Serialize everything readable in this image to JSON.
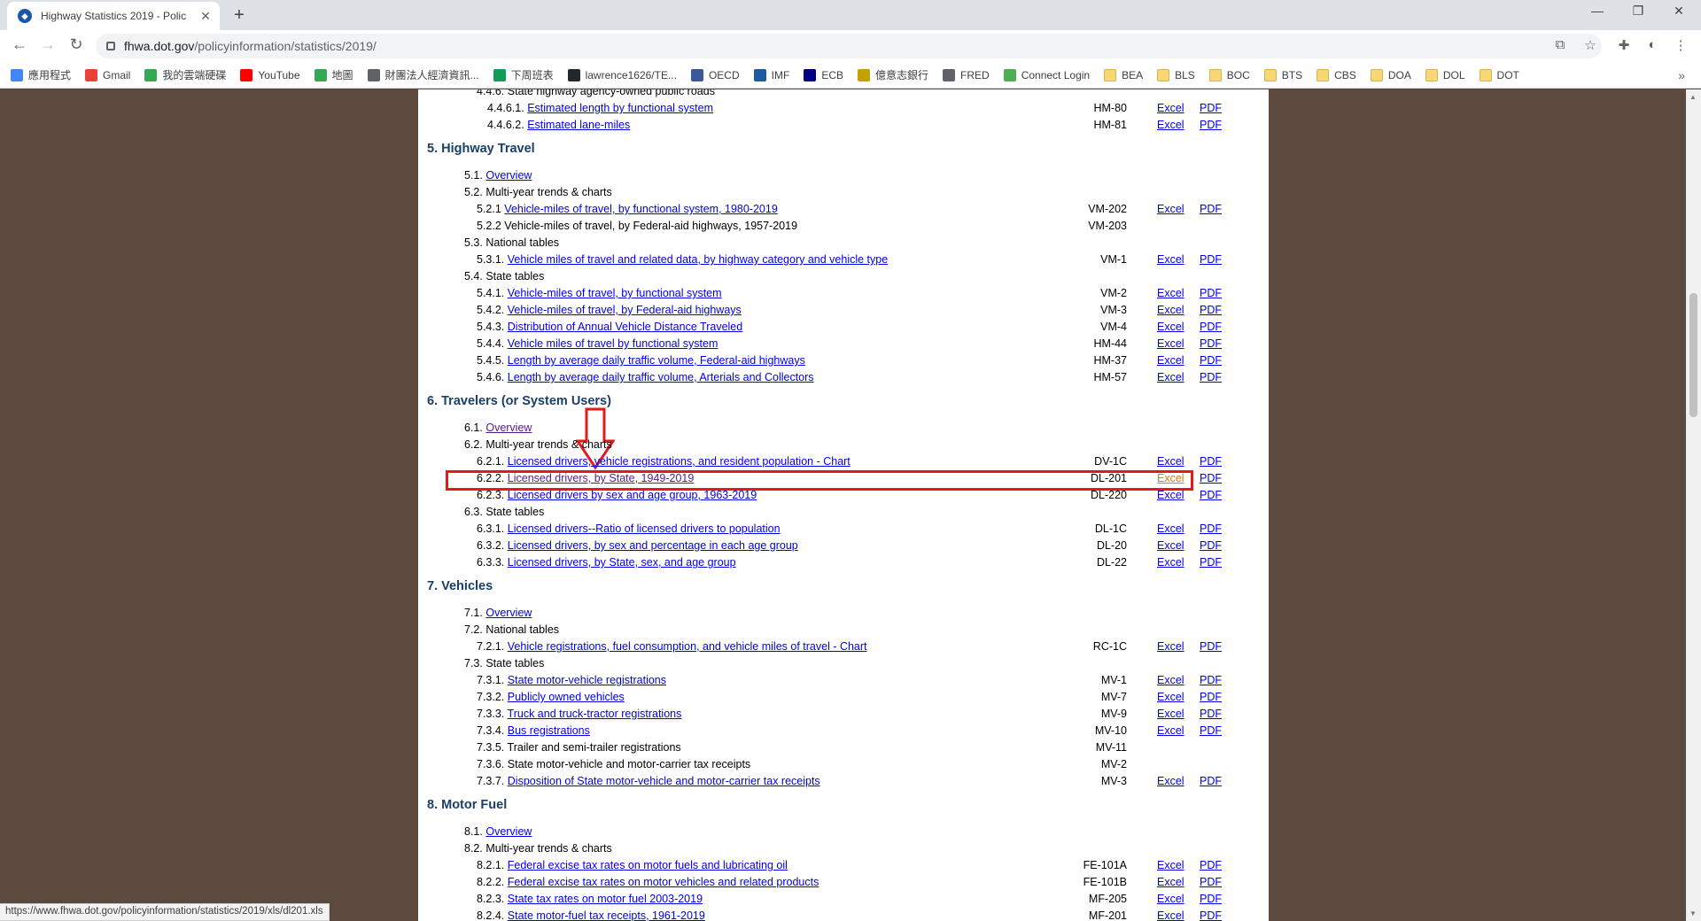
{
  "browser": {
    "tab_title": "Highway Statistics 2019 - Polic",
    "url_host": "fhwa.dot.gov",
    "url_path": "/policyinformation/statistics/2019/",
    "status_url": "https://www.fhwa.dot.gov/policyinformation/statistics/2019/xls/dl201.xls",
    "bookmarks": [
      "應用程式",
      "Gmail",
      "我的雲端硬碟",
      "YouTube",
      "地圖",
      "財團法人經濟資訊...",
      "下周班表",
      "lawrence1626/TE...",
      "OECD",
      "IMF",
      "ECB",
      "億意志銀行",
      "FRED",
      "Connect Login",
      "BEA",
      "BLS",
      "BOC",
      "BTS",
      "CBS",
      "DOA",
      "DOL",
      "DOT"
    ]
  },
  "page": {
    "rows": [
      {
        "type": "text",
        "num": "4.4.6.",
        "label": "State highway agency-owned public roads",
        "level": 3
      },
      {
        "type": "link",
        "num": "4.4.6.1.",
        "label": "Estimated length by functional system",
        "level": 4,
        "code": "HM-80",
        "excel": "Excel",
        "pdf": "PDF"
      },
      {
        "type": "link",
        "num": "4.4.6.2.",
        "label": "Estimated lane-miles",
        "level": 4,
        "code": "HM-81",
        "excel": "Excel",
        "pdf": "PDF"
      },
      {
        "type": "section",
        "label": "5. Highway Travel"
      },
      {
        "type": "link",
        "num": "5.1.",
        "label": "Overview",
        "level": 2
      },
      {
        "type": "text",
        "num": "5.2.",
        "label": "Multi-year trends & charts",
        "level": 2
      },
      {
        "type": "link",
        "num": "5.2.1",
        "label": "Vehicle-miles of travel, by functional system, 1980-2019",
        "level": 3,
        "code": "VM-202",
        "excel": "Excel",
        "pdf": "PDF"
      },
      {
        "type": "text",
        "num": "5.2.2",
        "label": "Vehicle-miles of travel, by Federal-aid highways, 1957-2019",
        "level": 3,
        "code": "VM-203"
      },
      {
        "type": "text",
        "num": "5.3.",
        "label": "National tables",
        "level": 2
      },
      {
        "type": "link",
        "num": "5.3.1.",
        "label": "Vehicle miles of travel and related data, by highway category and vehicle type",
        "level": 3,
        "code": "VM-1",
        "excel": "Excel",
        "pdf": "PDF"
      },
      {
        "type": "text",
        "num": "5.4.",
        "label": "State tables",
        "level": 2
      },
      {
        "type": "link",
        "num": "5.4.1.",
        "label": "Vehicle-miles of travel, by functional system",
        "level": 3,
        "code": "VM-2",
        "excel": "Excel",
        "pdf": "PDF"
      },
      {
        "type": "link",
        "num": "5.4.2.",
        "label": "Vehicle-miles of travel, by Federal-aid highways",
        "level": 3,
        "code": "VM-3",
        "excel": "Excel",
        "pdf": "PDF"
      },
      {
        "type": "link",
        "num": "5.4.3.",
        "label": "Distribution of Annual Vehicle Distance Traveled",
        "level": 3,
        "code": "VM-4",
        "excel": "Excel",
        "pdf": "PDF"
      },
      {
        "type": "link",
        "num": "5.4.4.",
        "label": "Vehicle miles of travel by functional system",
        "level": 3,
        "code": "HM-44",
        "excel": "Excel",
        "pdf": "PDF"
      },
      {
        "type": "link",
        "num": "5.4.5.",
        "label": "Length by average daily traffic volume, Federal-aid highways",
        "level": 3,
        "code": "HM-37",
        "excel": "Excel",
        "pdf": "PDF"
      },
      {
        "type": "link",
        "num": "5.4.6.",
        "label": "Length by average daily traffic volume, Arterials and Collectors",
        "level": 3,
        "code": "HM-57",
        "excel": "Excel",
        "pdf": "PDF"
      },
      {
        "type": "section",
        "label": "6. Travelers (or System Users)"
      },
      {
        "type": "link",
        "num": "6.1.",
        "label": "Overview",
        "level": 2,
        "visited": true
      },
      {
        "type": "text",
        "num": "6.2.",
        "label": "Multi-year trends & charts",
        "level": 2
      },
      {
        "type": "link",
        "num": "6.2.1.",
        "label": "Licensed drivers, vehicle registrations, and resident population - Chart",
        "level": 3,
        "code": "DV-1C",
        "excel": "Excel",
        "pdf": "PDF"
      },
      {
        "type": "link",
        "num": "6.2.2.",
        "label": "Licensed drivers, by State, 1949-2019",
        "level": 3,
        "code": "DL-201",
        "excel": "Excel",
        "pdf": "PDF",
        "visited": true,
        "hover": true
      },
      {
        "type": "link",
        "num": "6.2.3.",
        "label": "Licensed drivers by sex and age group, 1963-2019",
        "level": 3,
        "code": "DL-220",
        "excel": "Excel",
        "pdf": "PDF"
      },
      {
        "type": "text",
        "num": "6.3.",
        "label": "State tables",
        "level": 2
      },
      {
        "type": "link",
        "num": "6.3.1.",
        "label": "Licensed drivers--Ratio of licensed drivers to population",
        "level": 3,
        "code": "DL-1C",
        "excel": "Excel",
        "pdf": "PDF"
      },
      {
        "type": "link",
        "num": "6.3.2.",
        "label": "Licensed drivers, by sex and percentage in each age group",
        "level": 3,
        "code": "DL-20",
        "excel": "Excel",
        "pdf": "PDF"
      },
      {
        "type": "link",
        "num": "6.3.3.",
        "label": "Licensed drivers, by State, sex, and age group",
        "level": 3,
        "code": "DL-22",
        "excel": "Excel",
        "pdf": "PDF"
      },
      {
        "type": "section",
        "label": "7. Vehicles"
      },
      {
        "type": "link",
        "num": "7.1.",
        "label": "Overview",
        "level": 2
      },
      {
        "type": "text",
        "num": "7.2.",
        "label": "National tables",
        "level": 2
      },
      {
        "type": "link",
        "num": "7.2.1.",
        "label": "Vehicle registrations, fuel consumption, and vehicle miles of travel - Chart",
        "level": 3,
        "code": "RC-1C",
        "excel": "Excel",
        "pdf": "PDF"
      },
      {
        "type": "text",
        "num": "7.3.",
        "label": "State tables",
        "level": 2
      },
      {
        "type": "link",
        "num": "7.3.1.",
        "label": "State motor-vehicle registrations",
        "level": 3,
        "code": "MV-1",
        "excel": "Excel",
        "pdf": "PDF"
      },
      {
        "type": "link",
        "num": "7.3.2.",
        "label": "Publicly owned vehicles",
        "level": 3,
        "code": "MV-7",
        "excel": "Excel",
        "pdf": "PDF"
      },
      {
        "type": "link",
        "num": "7.3.3.",
        "label": "Truck and truck-tractor registrations",
        "level": 3,
        "code": "MV-9",
        "excel": "Excel",
        "pdf": "PDF"
      },
      {
        "type": "link",
        "num": "7.3.4.",
        "label": "Bus registrations",
        "level": 3,
        "code": "MV-10",
        "excel": "Excel",
        "pdf": "PDF"
      },
      {
        "type": "text",
        "num": "7.3.5.",
        "label": "Trailer and semi-trailer registrations",
        "level": 3,
        "code": "MV-11"
      },
      {
        "type": "text",
        "num": "7.3.6.",
        "label": "State motor-vehicle and motor-carrier tax receipts",
        "level": 3,
        "code": "MV-2"
      },
      {
        "type": "link",
        "num": "7.3.7.",
        "label": "Disposition of State motor-vehicle and motor-carrier tax receipts",
        "level": 3,
        "code": "MV-3",
        "excel": "Excel",
        "pdf": "PDF"
      },
      {
        "type": "section",
        "label": "8. Motor Fuel"
      },
      {
        "type": "link",
        "num": "8.1.",
        "label": "Overview",
        "level": 2
      },
      {
        "type": "text",
        "num": "8.2.",
        "label": "Multi-year trends & charts",
        "level": 2
      },
      {
        "type": "link",
        "num": "8.2.1.",
        "label": "Federal excise tax rates on motor fuels and lubricating oil",
        "level": 3,
        "code": "FE-101A",
        "excel": "Excel",
        "pdf": "PDF"
      },
      {
        "type": "link",
        "num": "8.2.2.",
        "label": "Federal excise tax rates on motor vehicles and related products",
        "level": 3,
        "code": "FE-101B",
        "excel": "Excel",
        "pdf": "PDF"
      },
      {
        "type": "link",
        "num": "8.2.3.",
        "label": "State tax rates on motor fuel 2003-2019",
        "level": 3,
        "code": "MF-205",
        "excel": "Excel",
        "pdf": "PDF"
      },
      {
        "type": "link",
        "num": "8.2.4.",
        "label": "State motor-fuel tax receipts, 1961-2019",
        "level": 3,
        "code": "MF-201",
        "excel": "Excel",
        "pdf": "PDF"
      }
    ]
  },
  "colors": {
    "link": "#0000ee",
    "visited": "#551a8b",
    "hover": "#e8760a",
    "annotation": "#e21a1a",
    "side": "#5c4a3f"
  }
}
